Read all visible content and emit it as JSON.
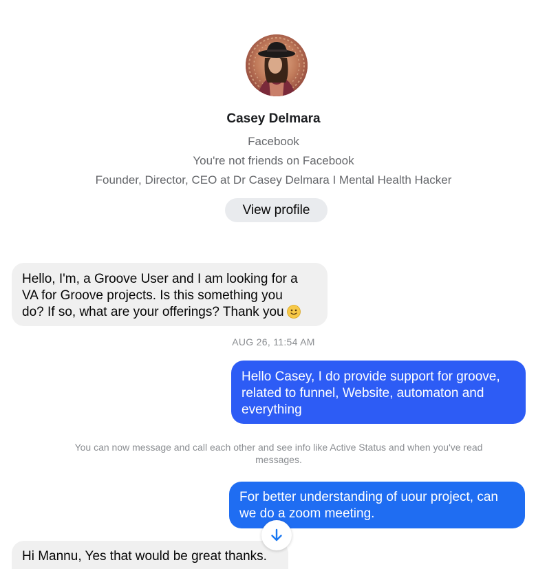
{
  "profile": {
    "name": "Casey Delmara",
    "platform": "Facebook",
    "friend_status": "You're not friends on Facebook",
    "bio": "Founder, Director, CEO at Dr Casey Delmara I Mental Health Hacker",
    "view_profile_label": "View profile"
  },
  "messages": [
    {
      "direction": "incoming",
      "lines": [
        "Hello, I'm, a Groove User and I am looking for a",
        "VA for Groove projects. Is this something you",
        "do? If so, what are your offerings? Thank you"
      ],
      "emoji": "slightly-smiling-face"
    },
    {
      "direction": "outgoing",
      "lines": [
        "Hello Casey, I do provide support for groove,",
        "related to funnel, Website, automaton and",
        "everything"
      ]
    },
    {
      "direction": "outgoing",
      "lines": [
        "For better understanding of uour project, can",
        "we do a zoom meeting."
      ]
    },
    {
      "direction": "incoming",
      "lines": [
        "Hi Mannu, Yes that would be great thanks."
      ]
    }
  ],
  "timestamp": "AUG 26, 11:54 AM",
  "system_note": {
    "line1": "You can now message and call each other and see info like Active Status and when you've read",
    "line2": "messages."
  },
  "scroll_button": {
    "icon": "arrow-down-icon"
  },
  "colors": {
    "outgoing_bubble": "#2d5cf5",
    "outgoing_bubble_alt": "#1f6df2",
    "incoming_bubble": "#f0f0f0",
    "scroll_arrow": "#1877f2"
  }
}
